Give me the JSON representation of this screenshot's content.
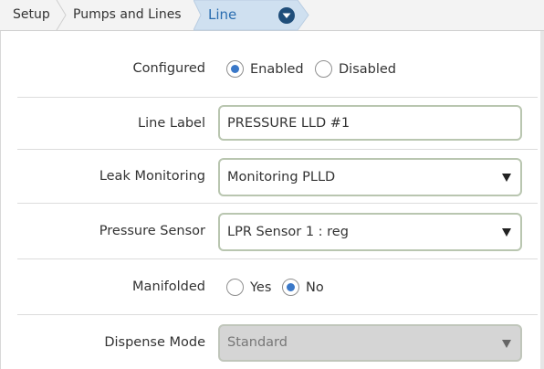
{
  "breadcrumb": {
    "items": [
      "Setup",
      "Pumps and Lines"
    ],
    "active": "Line"
  },
  "form": {
    "configured": {
      "label": "Configured",
      "options": [
        "Enabled",
        "Disabled"
      ],
      "selected": "Enabled"
    },
    "line_label": {
      "label": "Line Label",
      "value": "PRESSURE LLD #1"
    },
    "leak_monitoring": {
      "label": "Leak Monitoring",
      "value": "Monitoring PLLD"
    },
    "pressure_sensor": {
      "label": "Pressure Sensor",
      "value": "LPR Sensor 1 : reg"
    },
    "manifolded": {
      "label": "Manifolded",
      "options": [
        "Yes",
        "No"
      ],
      "selected": "No"
    },
    "dispense_mode": {
      "label": "Dispense Mode",
      "value": "Standard",
      "disabled": true
    }
  },
  "colors": {
    "accent": "#2a6db0",
    "radio_on": "#3a78c8",
    "active_crumb_bg": "#cfe0f0"
  },
  "icons": {
    "active_crumb_dropdown": "chevron-down-circle-icon",
    "select_caret": "caret-down-icon"
  }
}
